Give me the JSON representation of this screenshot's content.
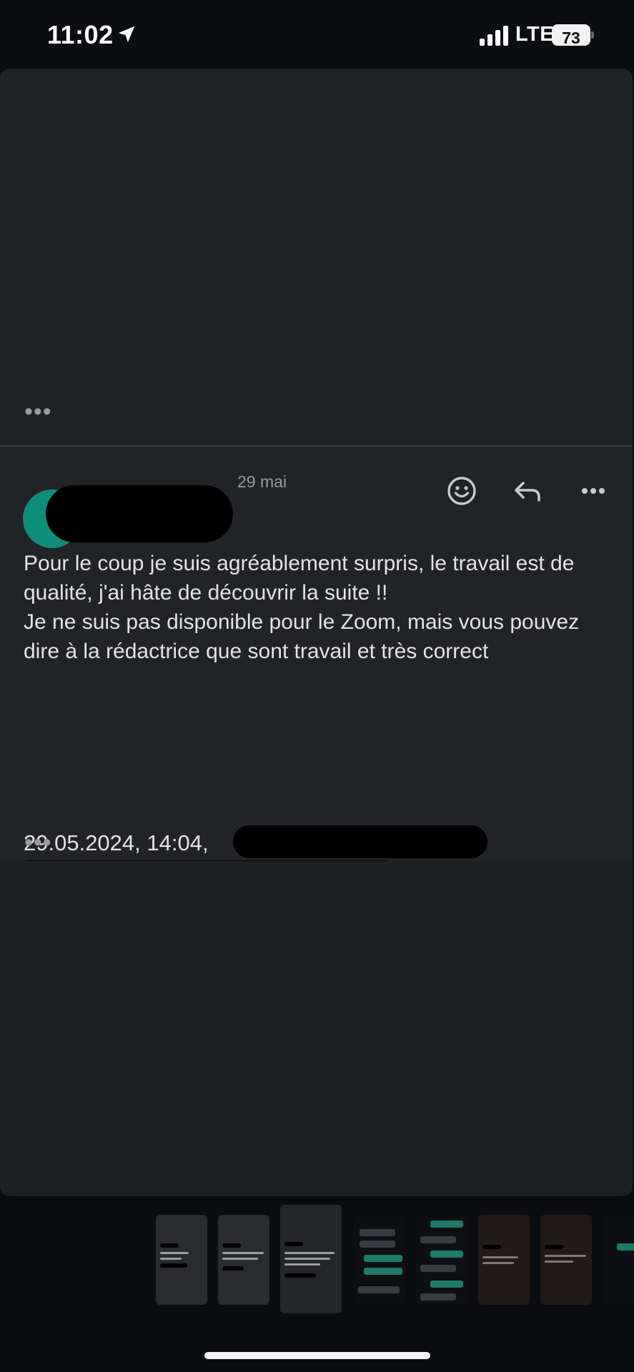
{
  "status_bar": {
    "time": "11:02",
    "network": "LTE",
    "battery": "73"
  },
  "message": {
    "date": "29 mai",
    "body": "Pour le coup je suis agréablement surpris, le travail est de qualité, j'ai hâte de découvrir la suite !!\nJe ne suis pas disponible pour le Zoom, mais vous pouvez dire à la rédactrice que sont travail et très correct",
    "quote_header": "29.05.2024, 14:04,",
    "avatar_color": "#0f8e7c"
  },
  "more_label": "•••",
  "icons": {
    "location": "location-arrow-icon",
    "signal": "signal-bars-icon",
    "emoji": "emoji-icon",
    "reply": "reply-icon",
    "more": "more-horizontal-icon"
  }
}
